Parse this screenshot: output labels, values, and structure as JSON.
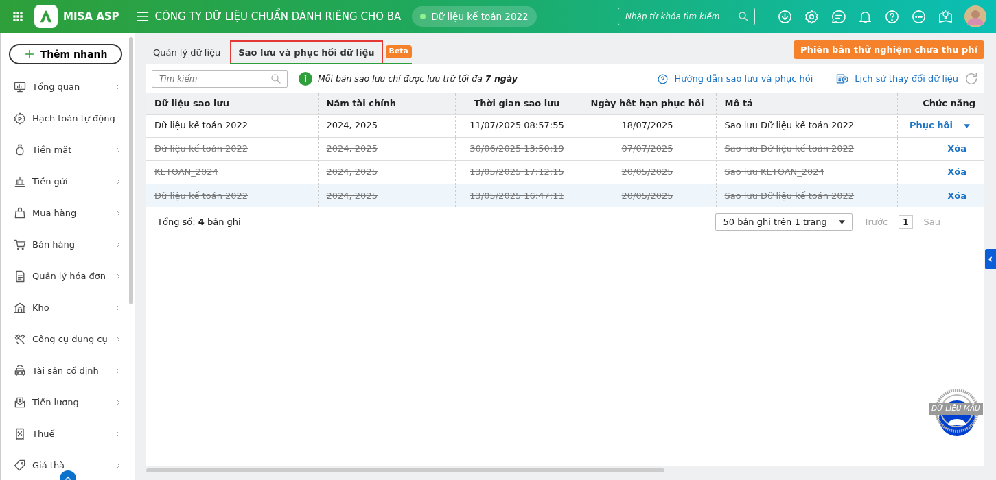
{
  "header": {
    "brand": "MISA ASP",
    "company": "CÔNG TY DỮ LIỆU CHUẨN DÀNH RIÊNG CHO BA",
    "dataset": "Dữ liệu kế toán 2022",
    "search": {
      "placeholder": "Nhập từ khóa tìm kiếm"
    }
  },
  "sidebar": {
    "quick_add": "Thêm nhanh",
    "items": [
      {
        "label": "Tổng quan",
        "kind": "monitor",
        "has_submenu": true
      },
      {
        "label": "Hạch toán tự động",
        "kind": "gear",
        "has_submenu": false
      },
      {
        "label": "Tiền mặt",
        "kind": "bag",
        "has_submenu": true
      },
      {
        "label": "Tiền gửi",
        "kind": "bank",
        "has_submenu": true
      },
      {
        "label": "Mua hàng",
        "kind": "shopping",
        "has_submenu": true
      },
      {
        "label": "Bán hàng",
        "kind": "cart",
        "has_submenu": true
      },
      {
        "label": "Quản lý hóa đơn",
        "kind": "document",
        "has_submenu": true
      },
      {
        "label": "Kho",
        "kind": "warehouse",
        "has_submenu": true
      },
      {
        "label": "Công cụ dụng cụ",
        "kind": "tools",
        "has_submenu": true
      },
      {
        "label": "Tài sản cố định",
        "kind": "car",
        "has_submenu": true
      },
      {
        "label": "Tiền lương",
        "kind": "salary",
        "has_submenu": true
      },
      {
        "label": "Thuế",
        "kind": "tax",
        "has_submenu": true
      },
      {
        "label": "Giá thà",
        "kind": "tag",
        "has_submenu": true
      }
    ]
  },
  "tabs": [
    {
      "label": "Quản lý dữ liệu",
      "selected": false
    },
    {
      "label": "Sao lưu và phục hồi dữ liệu",
      "selected": true,
      "badge": "Beta"
    }
  ],
  "trial_button": "Phiên bản thử nghiệm chưa thu phí",
  "toolbar": {
    "search": {
      "placeholder": "Tìm kiếm"
    },
    "notice": "Mỗi bản sao lưu chỉ được lưu trữ tối đa **7 ngày**",
    "guide_link": "Hướng dẫn sao lưu và phục hồi",
    "history_link": "Lịch sử thay đổi dữ liệu"
  },
  "table": {
    "columns": [
      "Dữ liệu sao lưu",
      "Năm tài chính",
      "Thời gian sao lưu",
      "Ngày hết hạn phục hồi",
      "Mô tả",
      "Chức năng"
    ],
    "rows": [
      {
        "cells": [
          "Dữ liệu kế toán 2022",
          "2024, 2025",
          "11/07/2025 08:57:55",
          "18/07/2025",
          "Sao lưu Dữ liệu kế toán 2022"
        ],
        "action": "Phục hồi",
        "kind": "restore",
        "expired": false,
        "selected": false
      },
      {
        "cells": [
          "Dữ liệu kế toán 2022",
          "2024, 2025",
          "30/06/2025 13:50:19",
          "07/07/2025",
          "Sao lưu Dữ liệu kế toán 2022"
        ],
        "action": "Xóa",
        "kind": "delete",
        "expired": true,
        "selected": false
      },
      {
        "cells": [
          "KETOAN_2024",
          "2024, 2025",
          "13/05/2025 17:12:15",
          "20/05/2025",
          "Sao lưu KETOAN_2024"
        ],
        "action": "Xóa",
        "kind": "delete",
        "expired": true,
        "selected": false
      },
      {
        "cells": [
          "Dữ liệu kế toán 2022",
          "2024, 2025",
          "13/05/2025 16:47:11",
          "20/05/2025",
          "Sao lưu Dữ liệu kế toán 2022"
        ],
        "action": "Xóa",
        "kind": "delete",
        "expired": true,
        "selected": true
      }
    ]
  },
  "footer": {
    "total": "Tổng số: **4** bản ghi",
    "page_size": "50 bản ghi trên 1 trang",
    "prev": "Trước",
    "page": "1",
    "next": "Sau"
  },
  "stamp": "DỮ LIỆU MẪU"
}
